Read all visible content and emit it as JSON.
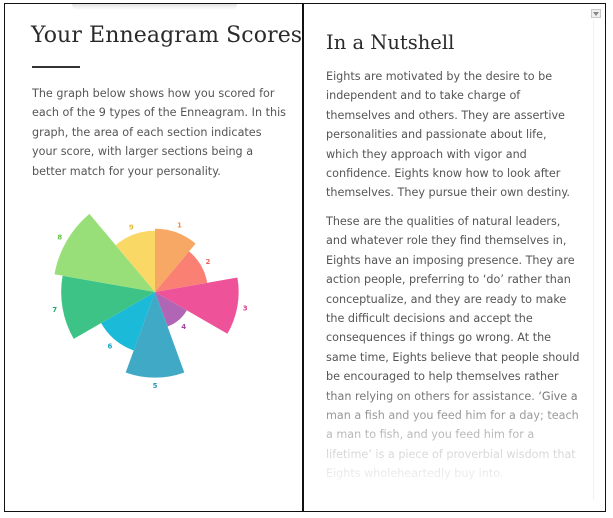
{
  "left": {
    "title": "Your Enneagram Scores",
    "intro": "The graph below shows how you scored for each of the 9 types of the Enneagram. In this graph, the area of each section indicates your score, with larger sections being a better match for your personality."
  },
  "right": {
    "title": "In a Nutshell",
    "paragraphs": [
      "Eights are motivated by the desire to be independent and to take charge of themselves and others. They are assertive personalities and passionate about life, which they approach with vigor and confidence. Eights know how to look after themselves. They pursue their own destiny.",
      "These are the qualities of natural leaders, and whatever role they find themselves in, Eights have an imposing presence. They are action people, preferring to ‘do’ rather than conceptualize, and they are ready to make the difficult decisions and accept the consequences if things go wrong. At the same time, Eights believe that people should be encouraged to help themselves rather than relying on others for assistance. ‘Give a man a fish and you feed him for a day; teach a man to fish, and you feed him for a lifetime’ is a piece of proverbial wisdom that Eights wholeheartedly buy into."
    ]
  },
  "chart_data": {
    "type": "polar-area",
    "categories": [
      "1",
      "2",
      "3",
      "4",
      "5",
      "6",
      "7",
      "8",
      "9"
    ],
    "values": [
      0.62,
      0.52,
      0.82,
      0.36,
      0.84,
      0.61,
      0.92,
      1.0,
      0.6
    ],
    "colors": [
      "#f7a865",
      "#f98072",
      "#ee539a",
      "#b165b5",
      "#40a9c6",
      "#1cbad9",
      "#3ec386",
      "#98df79",
      "#fad866"
    ],
    "label_colors": [
      "#f08a3c",
      "#f06258",
      "#e23c8b",
      "#a0479d",
      "#2e95b7",
      "#14a6c4",
      "#2aa36a",
      "#6cc24c",
      "#e8bb3a"
    ]
  }
}
